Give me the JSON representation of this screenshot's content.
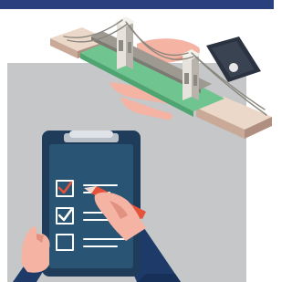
{
  "illustration": {
    "subject": "bridge-inspection-checklist",
    "icons": [
      "bridge-icon",
      "clipboard-icon",
      "checkbox-icon",
      "pen-icon",
      "hand-icon",
      "tablet-icon"
    ],
    "colors": {
      "top_band": "#2a3f7e",
      "panel_gray": "#c5c7c8",
      "bridge_deck": "#6fc490",
      "bridge_base_light": "#ecd8c8",
      "bridge_base_dark": "#c9a998",
      "tower_light": "#e6e3dc",
      "tower_dark": "#b8b4ac",
      "clipboard_dark": "#1f3d5a",
      "clipboard_paper": "#2a5473",
      "check_accent": "#e5533a",
      "skin": "#f4b3a3",
      "sleeve": "#1e3a68",
      "tablet": "#2c3340"
    },
    "checklist": {
      "items": [
        {
          "checked": true,
          "accent": "red"
        },
        {
          "checked": true,
          "accent": "white"
        },
        {
          "checked": false,
          "accent": "white"
        }
      ]
    }
  }
}
